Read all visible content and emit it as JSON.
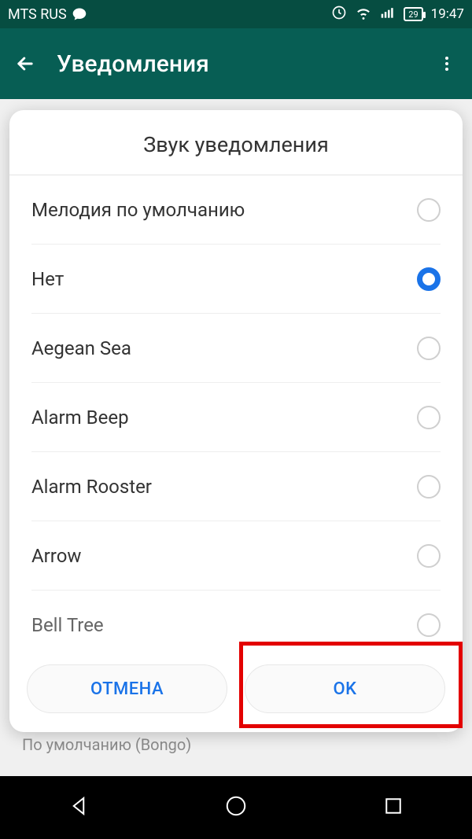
{
  "status": {
    "carrier": "MTS RUS",
    "battery": "29",
    "time": "19:47"
  },
  "appbar": {
    "title": "Уведомления"
  },
  "dialog": {
    "title": "Звук уведомления",
    "options": [
      {
        "label": "Мелодия по умолчанию",
        "selected": false
      },
      {
        "label": "Нет",
        "selected": true
      },
      {
        "label": "Aegean Sea",
        "selected": false
      },
      {
        "label": "Alarm Beep",
        "selected": false
      },
      {
        "label": "Alarm Rooster",
        "selected": false
      },
      {
        "label": "Arrow",
        "selected": false
      },
      {
        "label": "Bell Tree",
        "selected": false
      }
    ],
    "cancel": "ОТМЕНА",
    "ok": "OK"
  },
  "background_setting": {
    "title": "Звук уведомления",
    "subtitle": "По умолчанию (Bongo)"
  }
}
